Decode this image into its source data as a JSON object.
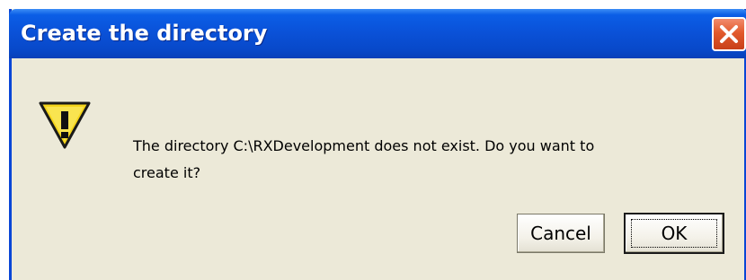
{
  "dialog": {
    "title": "Create the directory",
    "message_line1": "The directory C:\\RXDevelopment does not exist.  Do you want to",
    "message_line2": "create it?",
    "icon": "warning-icon",
    "buttons": {
      "cancel_label": "Cancel",
      "ok_label": "OK"
    },
    "default_button": "OK"
  },
  "colors": {
    "titlebar": "#0a52d9",
    "window_body": "#ece9d8",
    "close_button": "#e25a2c",
    "warning_fill": "#f5d51c"
  }
}
